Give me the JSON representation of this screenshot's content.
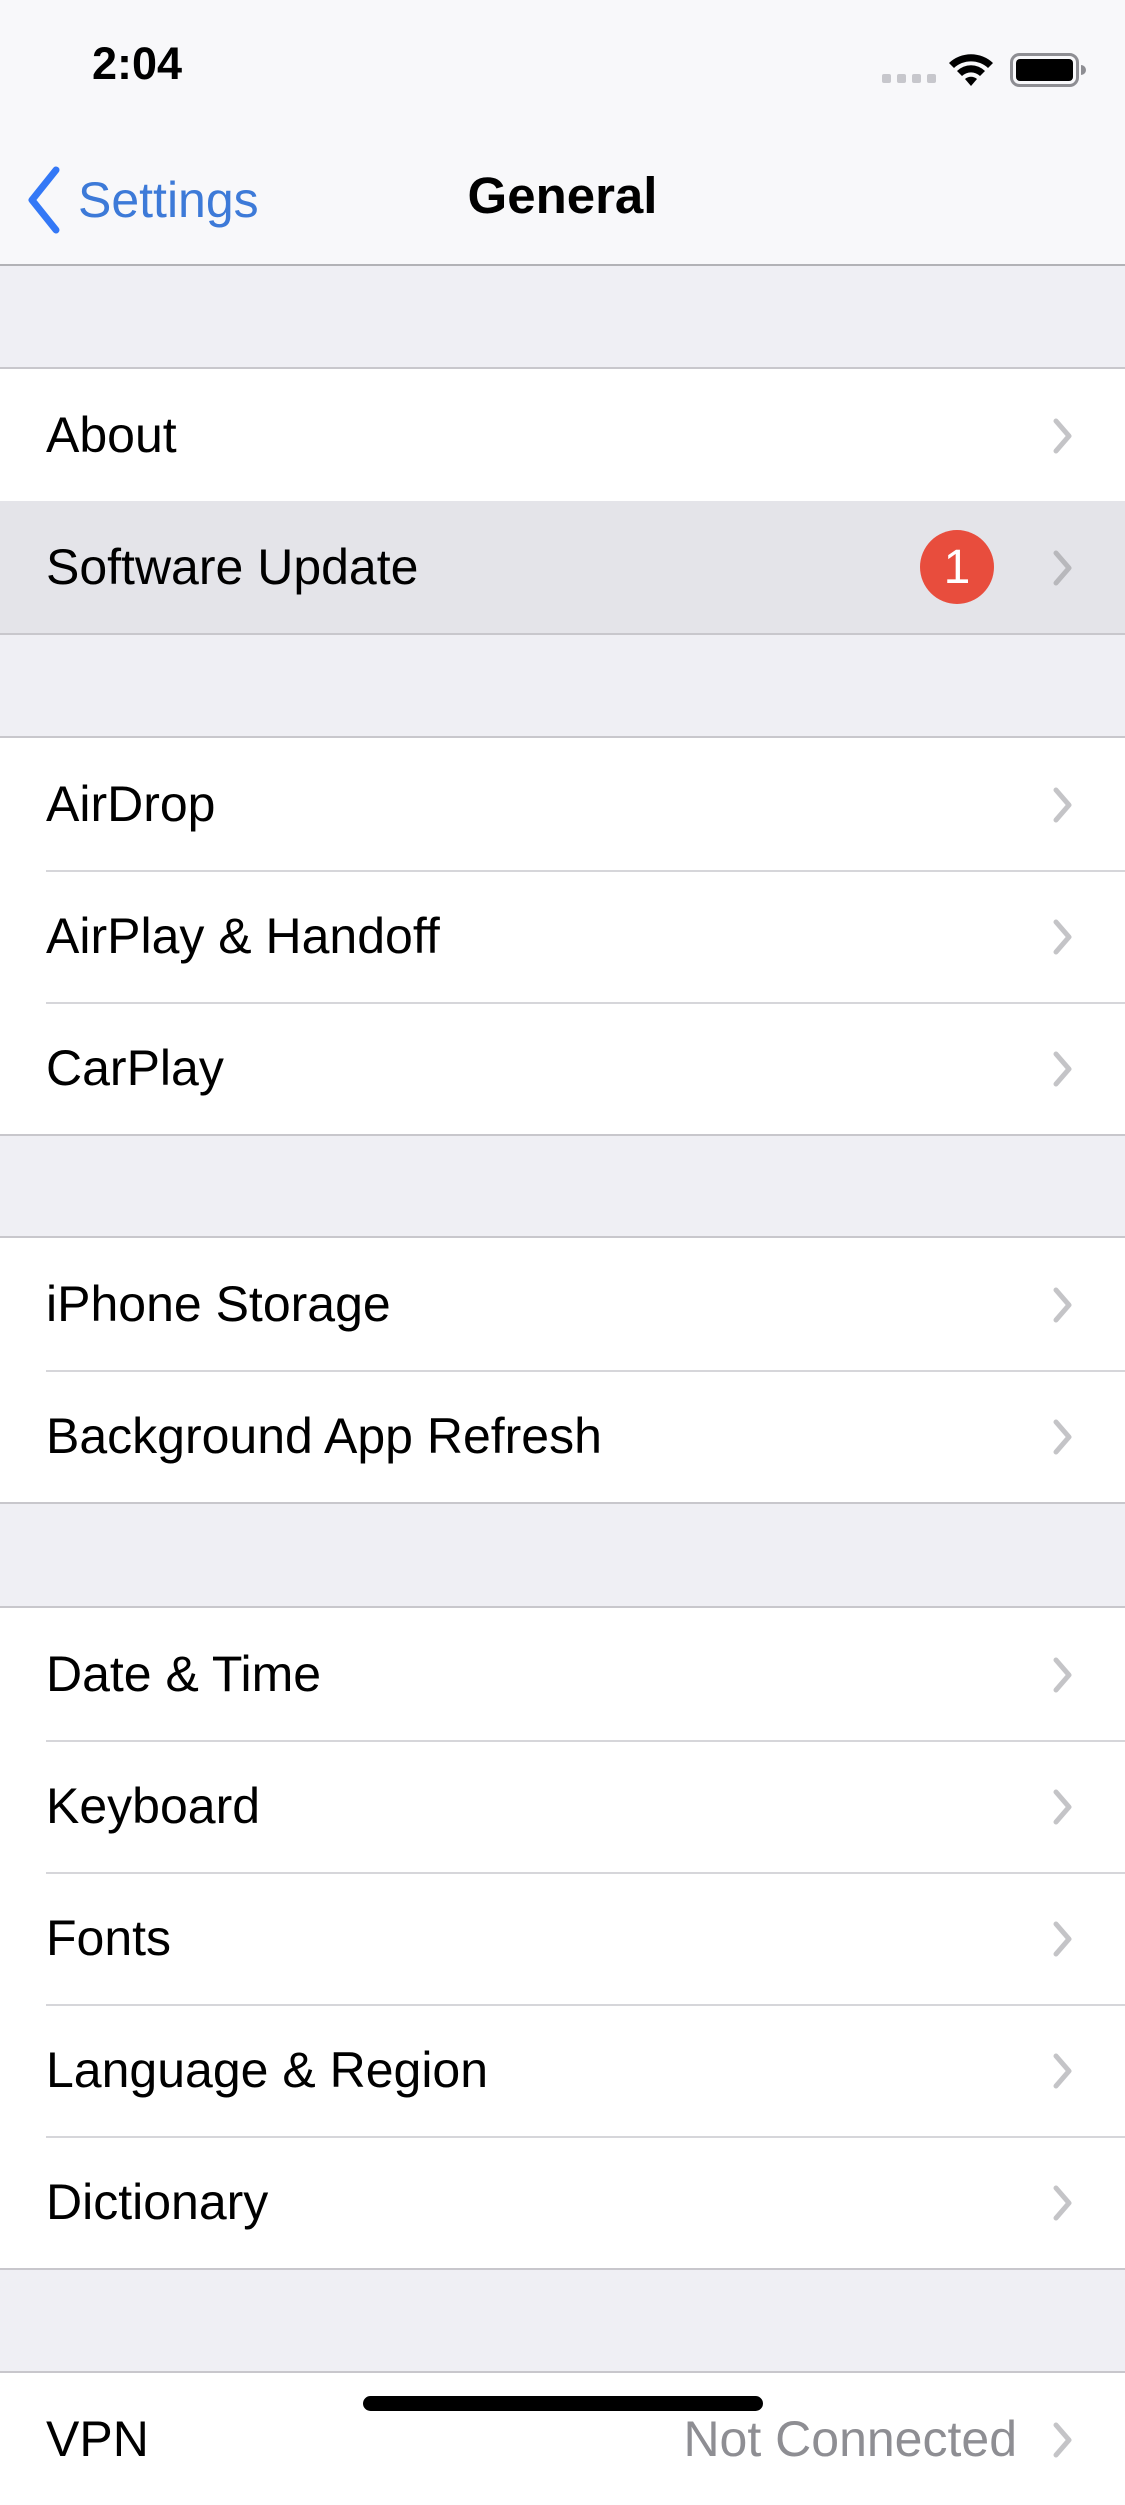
{
  "status_bar": {
    "time": "2:04",
    "signal_icon": "cellular-signal-icon",
    "wifi_icon": "wifi-icon",
    "battery_icon": "battery-icon"
  },
  "nav": {
    "back_label": "Settings",
    "back_icon": "chevron-left-icon",
    "title": "General"
  },
  "sections": [
    {
      "rows": [
        {
          "label": "About"
        },
        {
          "label": "Software Update",
          "badge": "1",
          "highlighted": true
        }
      ]
    },
    {
      "rows": [
        {
          "label": "AirDrop"
        },
        {
          "label": "AirPlay & Handoff"
        },
        {
          "label": "CarPlay"
        }
      ]
    },
    {
      "rows": [
        {
          "label": "iPhone Storage"
        },
        {
          "label": "Background App Refresh"
        }
      ]
    },
    {
      "rows": [
        {
          "label": "Date & Time"
        },
        {
          "label": "Keyboard"
        },
        {
          "label": "Fonts"
        },
        {
          "label": "Language & Region"
        },
        {
          "label": "Dictionary"
        }
      ]
    },
    {
      "rows": [
        {
          "label": "VPN",
          "value": "Not Connected"
        }
      ]
    }
  ],
  "colors": {
    "accent": "#3d7ad8",
    "badge": "#e84d3d",
    "grouped_background": "#efeff4",
    "highlight": "#e4e4e9"
  }
}
